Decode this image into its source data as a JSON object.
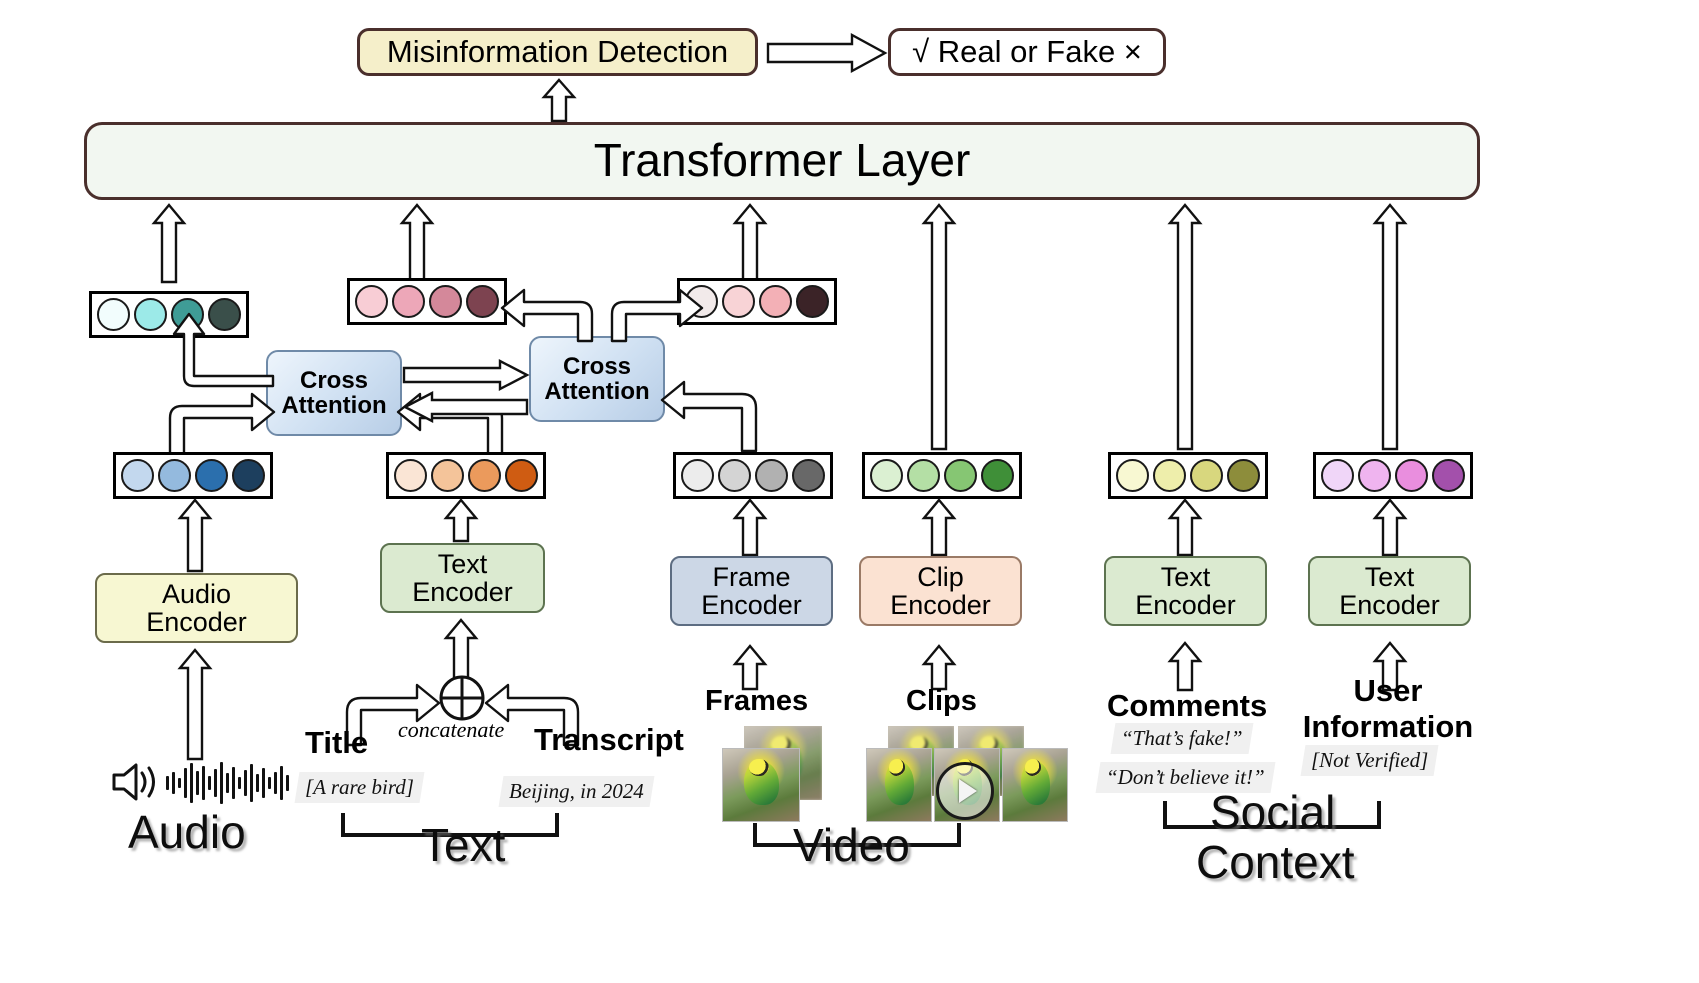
{
  "output": {
    "task_label": "Misinformation Detection",
    "result_label": "√ Real or Fake ×"
  },
  "backbone": {
    "label": "Transformer Layer"
  },
  "fusion": {
    "cross_attention_left": "Cross\nAttention",
    "cross_attention_left_line1": "Cross",
    "cross_attention_left_line2": "Attention",
    "cross_attention_right_line1": "Cross",
    "cross_attention_right_line2": "Attention"
  },
  "encoders": {
    "audio_line1": "Audio",
    "audio_line2": "Encoder",
    "text_line1": "Text",
    "text_line2": "Encoder",
    "frame_line1": "Frame",
    "frame_line2": "Encoder",
    "clip_line1": "Clip",
    "clip_line2": "Encoder",
    "comments_text_line1": "Text",
    "comments_text_line2": "Encoder",
    "user_text_line1": "Text",
    "user_text_line2": "Encoder"
  },
  "inputs": {
    "title_label": "Title",
    "transcript_label": "Transcript",
    "concatenate_label": "concatenate",
    "title_value": "[A rare bird]",
    "transcript_value": "Beijing, in 2024",
    "frames_label": "Frames",
    "clips_label": "Clips",
    "comments_label": "Comments",
    "user_info_line1": "User",
    "user_info_line2": "Information",
    "comment_1": "“That’s fake!”",
    "comment_2": "“Don’t believe it!”",
    "user_value": "[Not Verified]"
  },
  "modalities": {
    "audio": "Audio",
    "text": "Text",
    "video": "Video",
    "social_line1": "Social",
    "social_line2": "Context"
  },
  "token_rows": {
    "audio_fused": [
      "#f2fdfd",
      "#9ceae8",
      "#3f9c96",
      "#3a4f4a"
    ],
    "text_fused": [
      "#f8cdd5",
      "#eda7b8",
      "#d4889a",
      "#7d4350"
    ],
    "video_fused": [
      "#f2eaea",
      "#f8d3d6",
      "#f3b0b6",
      "#3b2327"
    ],
    "audio_raw": [
      "#c3d8ee",
      "#94bade",
      "#2b6fad",
      "#1d3f5e"
    ],
    "text_raw": [
      "#fae5d5",
      "#f4c49a",
      "#eb9a5c",
      "#cf5c12"
    ],
    "frame_raw": [
      "#ececec",
      "#d4d4d4",
      "#b1b1b1",
      "#686868"
    ],
    "clip_raw": [
      "#dbf0d2",
      "#b4dfa5",
      "#86c673",
      "#3f8f38"
    ],
    "comments_raw": [
      "#f8f8d2",
      "#eeeeab",
      "#d8d77e",
      "#8d8d3b"
    ],
    "user_raw": [
      "#f0d6f8",
      "#efb4ef",
      "#e98ede",
      "#a350ab"
    ]
  },
  "colors": {
    "task_box_fill": "#f5efca",
    "transformer_fill": "#f2f7f1",
    "box_border": "#4a2f2c",
    "cross_attention_fill": "#cfe0f2",
    "audio_encoder_fill": "#f7f7d2",
    "text_encoder_fill": "#dbead0",
    "frame_encoder_fill": "#ccd7e6",
    "clip_encoder_fill": "#fbe2d2"
  },
  "icons": {
    "speaker": "speaker-icon",
    "waveform": "audio-waveform-icon",
    "concatenate": "circled-plus-icon",
    "play": "play-button-icon"
  }
}
